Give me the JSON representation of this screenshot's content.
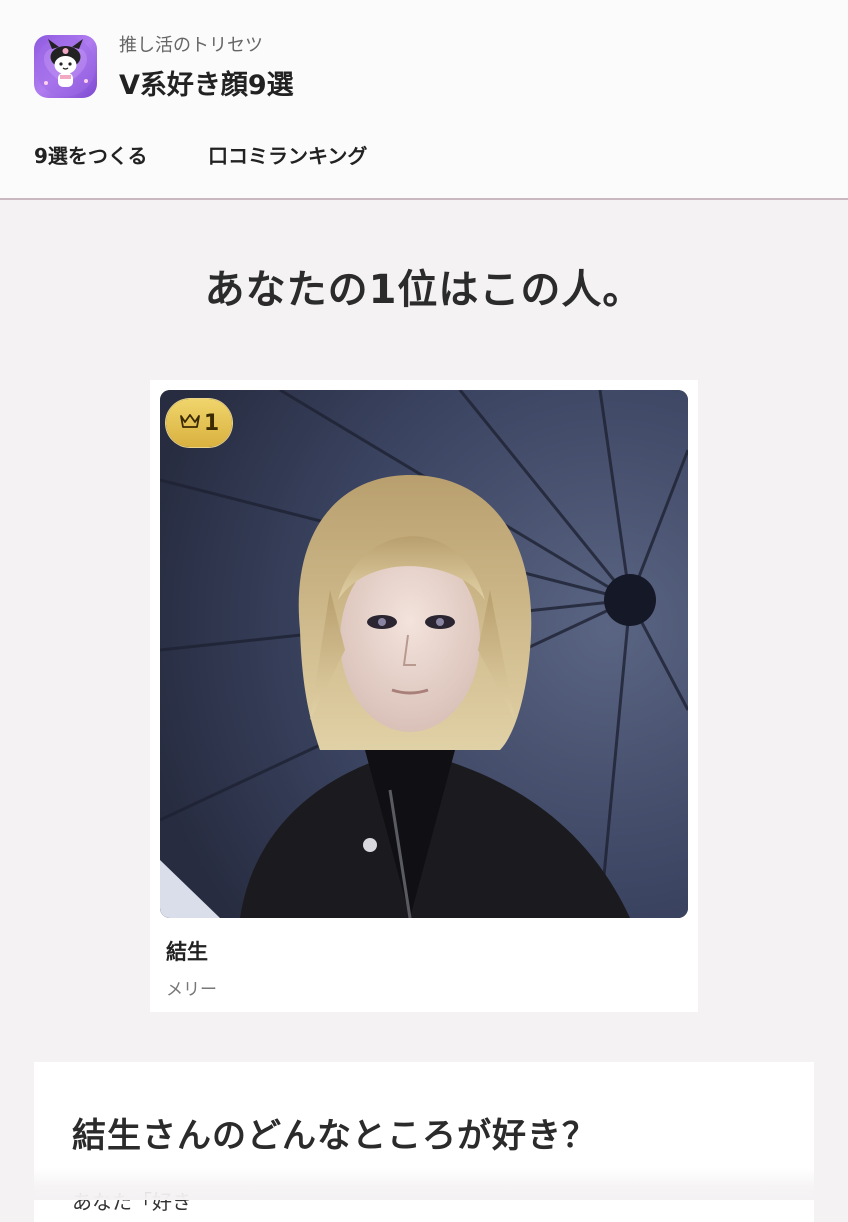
{
  "app": {
    "subtitle": "推し活のトリセツ",
    "title": "V系好き顔9選",
    "icon": "kuromi-app-icon"
  },
  "nav": {
    "make": "9選をつくる",
    "ranking": "口コミランキング"
  },
  "headline": "あなたの1位はこの人。",
  "rank_card": {
    "badge_icon": "crown-icon",
    "rank": "1",
    "name": "結生",
    "group": "メリー"
  },
  "question": {
    "text": "結生さんのどんなところが好き？",
    "answer_partial": "あなた「好き"
  },
  "colors": {
    "background": "#f4f2f3",
    "badge_gold": "#e4c452",
    "accent_divider": "#c9b8bf"
  }
}
